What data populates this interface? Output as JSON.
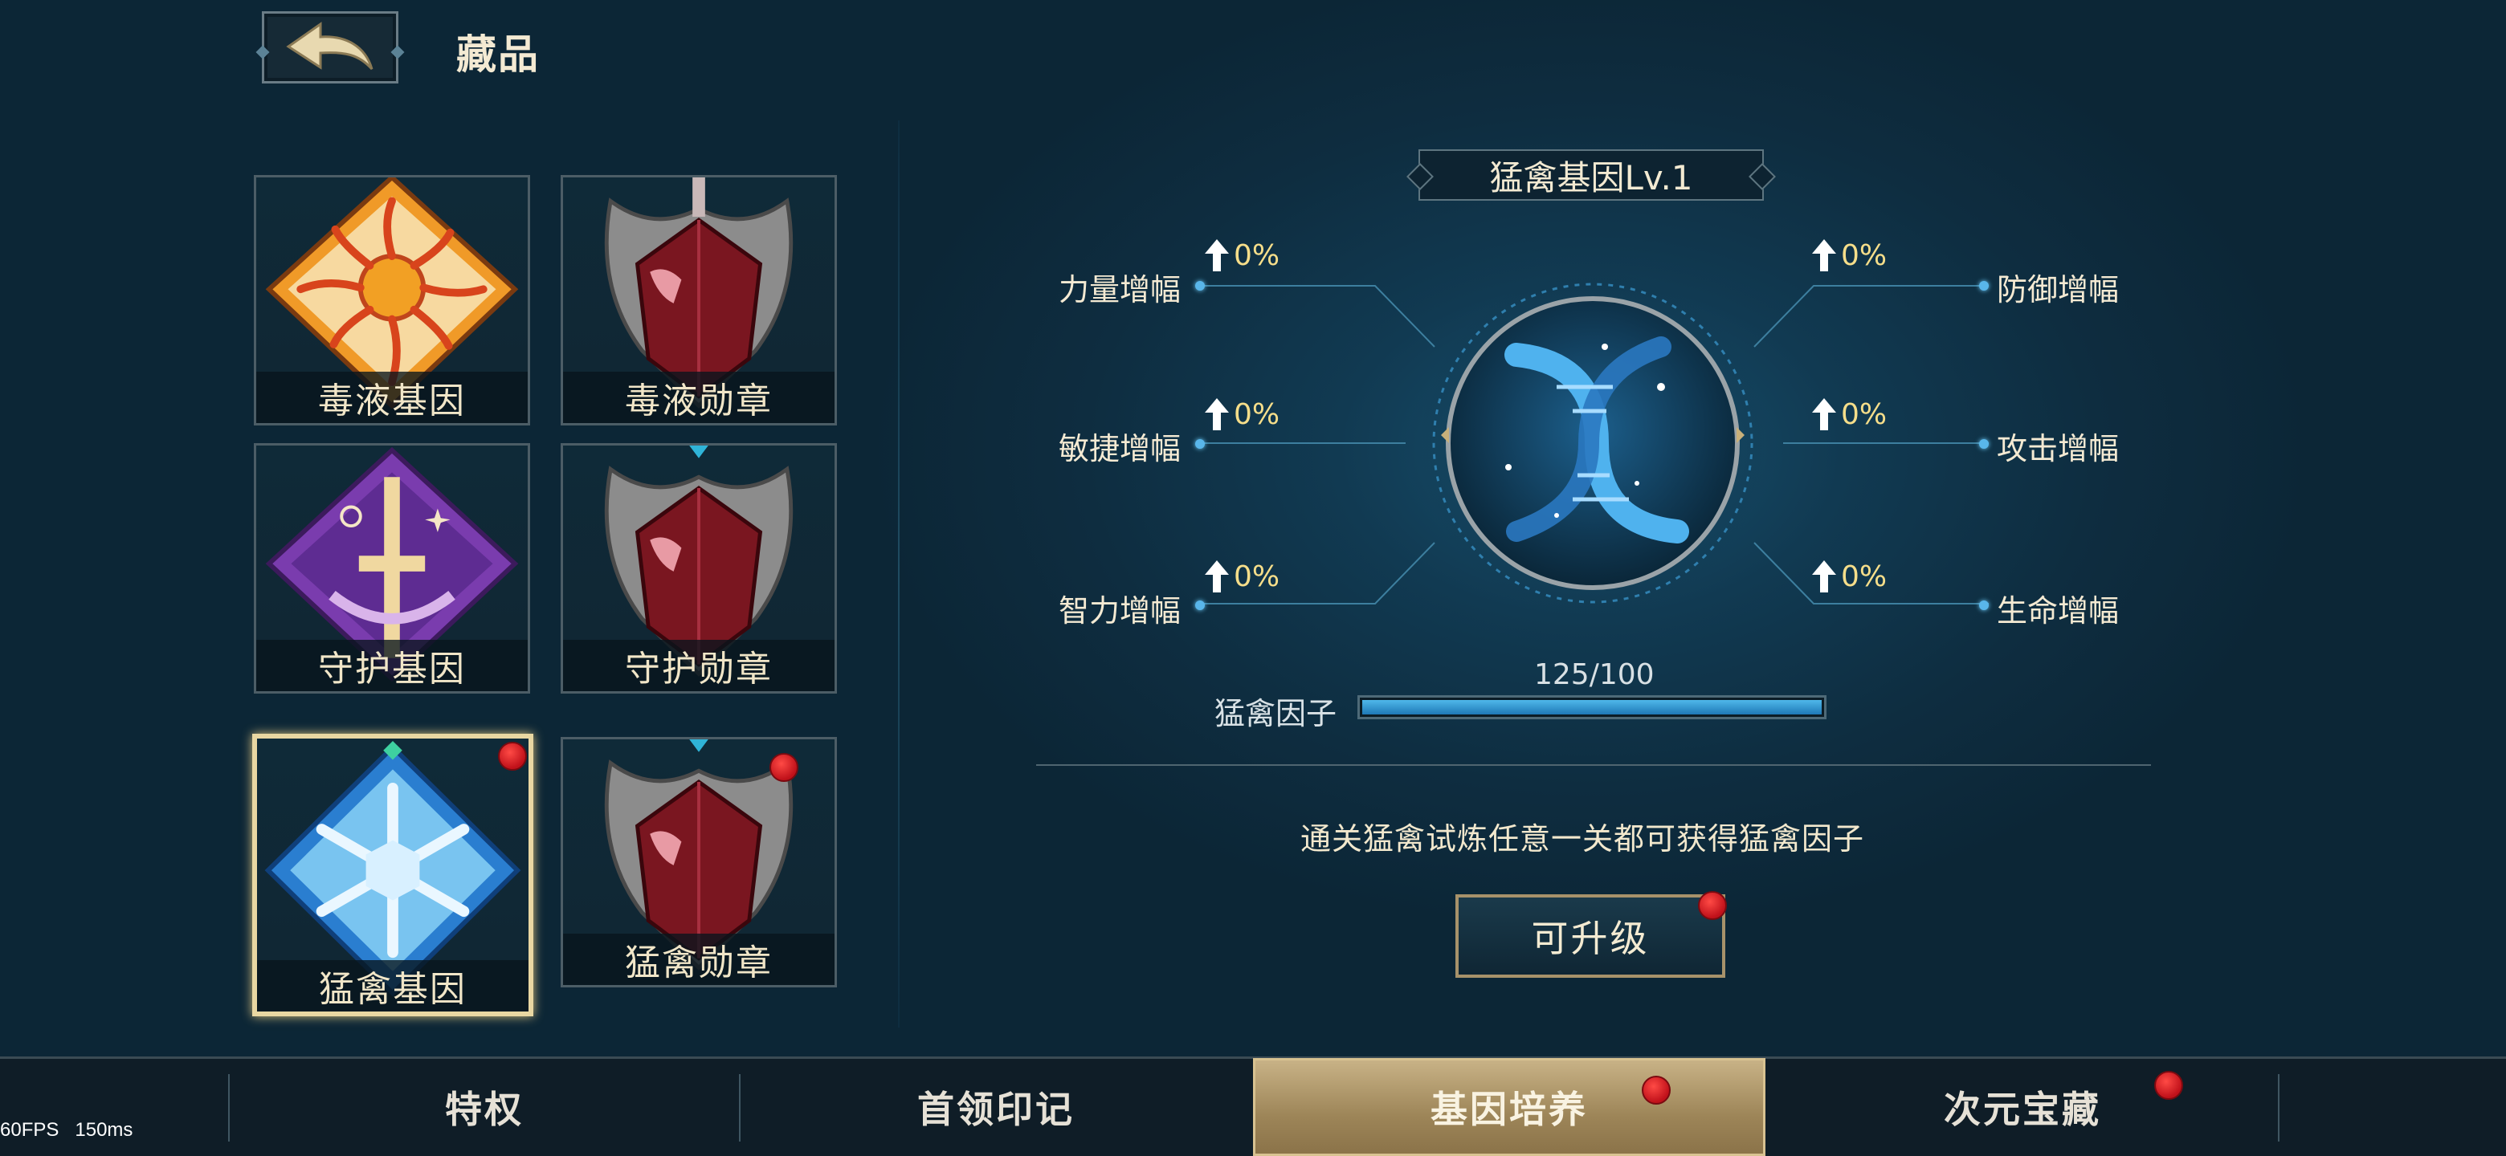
{
  "header": {
    "back_icon": "back-arrow-icon",
    "title": "藏品"
  },
  "collection": {
    "items": [
      {
        "label": "毒液基因",
        "icon": "sun-gene-emblem",
        "selected": false,
        "red_dot": false
      },
      {
        "label": "毒液勋章",
        "icon": "crimson-medal-emblem",
        "selected": false,
        "red_dot": false
      },
      {
        "label": "守护基因",
        "icon": "moon-star-gene-emblem",
        "selected": false,
        "red_dot": false
      },
      {
        "label": "守护勋章",
        "icon": "crimson-medal-emblem",
        "selected": false,
        "red_dot": false
      },
      {
        "label": "猛禽基因",
        "icon": "snowflake-gene-emblem",
        "selected": true,
        "red_dot": true
      },
      {
        "label": "猛禽勋章",
        "icon": "crimson-medal-emblem",
        "selected": false,
        "red_dot": true
      }
    ]
  },
  "detail": {
    "title": "猛禽基因Lv.1",
    "center_icon": "dna-helix-icon",
    "stats_left": [
      {
        "label": "力量增幅",
        "value": "0%"
      },
      {
        "label": "敏捷增幅",
        "value": "0%"
      },
      {
        "label": "智力增幅",
        "value": "0%"
      }
    ],
    "stats_right": [
      {
        "label": "防御增幅",
        "value": "0%"
      },
      {
        "label": "攻击增幅",
        "value": "0%"
      },
      {
        "label": "生命增幅",
        "value": "0%"
      }
    ],
    "progress": {
      "label": "猛禽因子",
      "text": "125/100",
      "fill_fraction": 1.0
    },
    "hint": "通关猛禽试炼任意一关都可获得猛禽因子",
    "upgrade_button": "可升级"
  },
  "tabs": [
    {
      "label": "特权",
      "active": false,
      "red_dot": false
    },
    {
      "label": "首领印记",
      "active": false,
      "red_dot": false
    },
    {
      "label": "基因培养",
      "active": true,
      "red_dot": true
    },
    {
      "label": "次元宝藏",
      "active": false,
      "red_dot": true
    }
  ],
  "debug": {
    "fps": "60FPS",
    "latency": "150ms"
  },
  "colors": {
    "background": "#0e2d40",
    "accent_gold": "#d8c291",
    "stat_value": "#f6de8a",
    "progress_fill": "#3a9ad6",
    "red_dot": "#d41822"
  }
}
